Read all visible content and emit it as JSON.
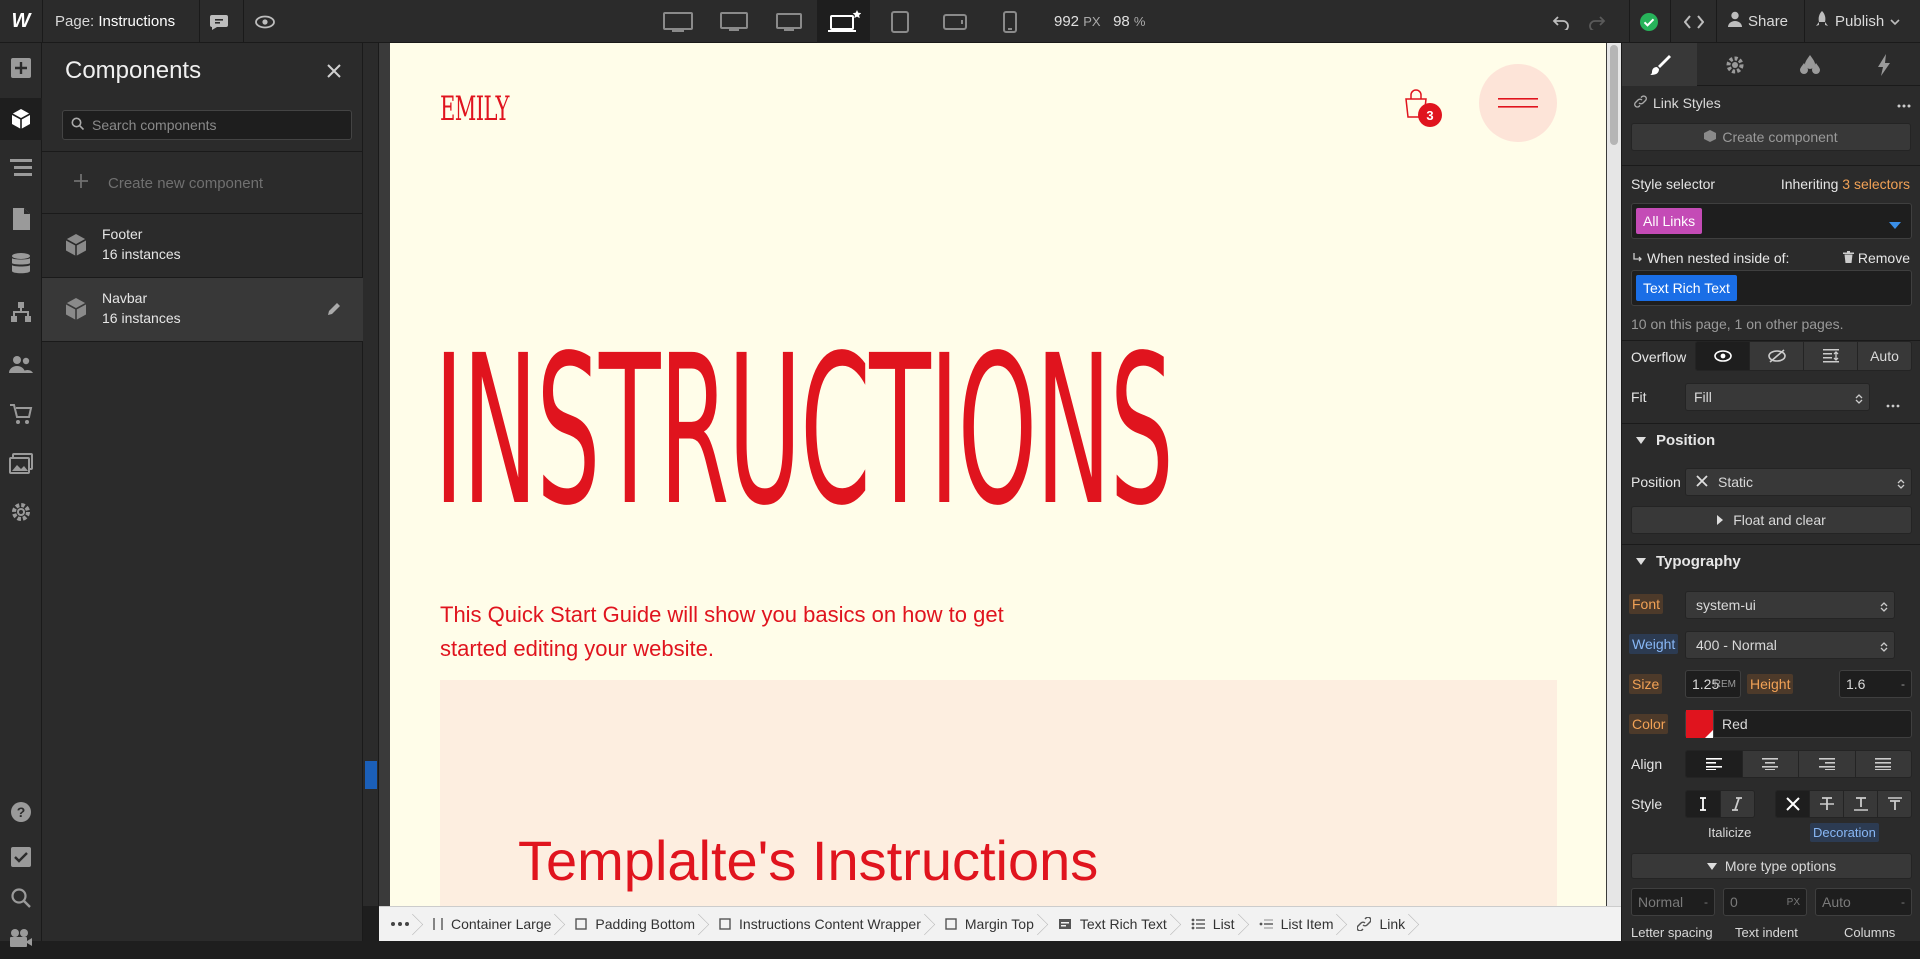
{
  "topbar": {
    "logo": "W",
    "page_prefix": "Page:",
    "page_name": "Instructions",
    "width_value": "992",
    "width_unit": "PX",
    "zoom_value": "98",
    "zoom_unit": "%",
    "share_label": "Share",
    "publish_label": "Publish"
  },
  "components_panel": {
    "title": "Components",
    "search_placeholder": "Search components",
    "create_label": "Create new component",
    "items": [
      {
        "name": "Footer",
        "instances": "16 instances"
      },
      {
        "name": "Navbar",
        "instances": "16 instances"
      }
    ]
  },
  "canvas": {
    "brand": "EMILY",
    "cart_count": "3",
    "hero_title": "INSTRUCTIONS",
    "intro_line1": "This Quick Start Guide will show you basics on how to get",
    "intro_line2": "started editing your website.",
    "section_title": "Templalte's Instructions",
    "accent_color": "#e0141e",
    "bg_color": "#fffde9"
  },
  "breadcrumb": [
    "Container Large",
    "Padding Bottom",
    "Instructions Content Wrapper",
    "Margin Top",
    "Text Rich Text",
    "List",
    "List Item",
    "Link"
  ],
  "style_panel": {
    "element_title": "Link Styles",
    "create_component_label": "Create component",
    "style_selector_label": "Style selector",
    "inheriting_label": "Inheriting",
    "inheriting_count": "3 selectors",
    "selector_chip": "All Links",
    "nested_label": "When nested inside of:",
    "remove_label": "Remove",
    "nested_chip": "Text Rich Text",
    "usage_note": "10 on this page, 1 on other pages.",
    "overflow_label": "Overflow",
    "overflow_auto": "Auto",
    "fit_label": "Fit",
    "fit_value": "Fill",
    "position_section": "Position",
    "position_label": "Position",
    "position_value": "Static",
    "float_label": "Float and clear",
    "typography_section": "Typography",
    "font_label": "Font",
    "font_value": "system-ui",
    "weight_label": "Weight",
    "weight_value": "400 - Normal",
    "size_label": "Size",
    "size_value": "1.25",
    "size_unit": "REM",
    "height_label": "Height",
    "height_value": "1.6",
    "height_unit": "-",
    "color_label": "Color",
    "color_value": "Red",
    "color_swatch": "#e0141e",
    "align_label": "Align",
    "style_label": "Style",
    "italicize_label": "Italicize",
    "decoration_label": "Decoration",
    "more_type_label": "More type options",
    "letter_spacing_value": "Normal",
    "letter_spacing_unit": "-",
    "text_indent_value": "0",
    "text_indent_unit": "PX",
    "columns_value": "Auto",
    "columns_unit": "-",
    "letter_spacing_label": "Letter spacing",
    "text_indent_label": "Text indent",
    "columns_label": "Columns"
  }
}
